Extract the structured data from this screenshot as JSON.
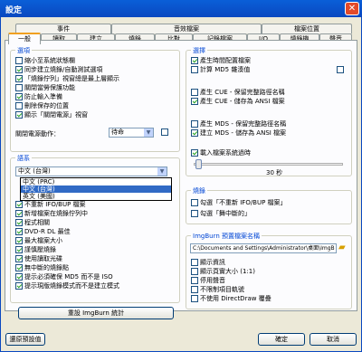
{
  "window": {
    "title": "設定",
    "close": "✕"
  },
  "tabs_back": [
    "事件",
    "音效檔案",
    "檔案位置"
  ],
  "tabs_front": [
    "一般",
    "讀取",
    "建立",
    "燒錄",
    "比對",
    "記錄檔案",
    "I/O",
    "燒錄機",
    "聲音"
  ],
  "options": {
    "title": "選項",
    "items": [
      {
        "label": "縮小至系統狀態欄",
        "checked": false
      },
      {
        "label": "同步建立燒錄/自動測試選項",
        "checked": true
      },
      {
        "label": "「燒錄佇列」視窗總是最上層顯示",
        "checked": true
      },
      {
        "label": "關閉當勞保護功能",
        "checked": false
      },
      {
        "label": "防止輸入準備",
        "checked": true
      },
      {
        "label": "刪除保存的位置",
        "checked": false
      },
      {
        "label": "顯示「關閉電源」視窗",
        "checked": true
      }
    ],
    "shutdown_label": "關閉電源動作：",
    "shutdown_value": "待命"
  },
  "language": {
    "title": "語系",
    "selected": "中文 (台灣)",
    "options": [
      "中文 (台灣)",
      "中文 (PRC)",
      "中文 (台灣)",
      "英文 (美國)"
    ],
    "items": [
      {
        "label": "不重新 IFO/BUP 檔案",
        "checked": true
      },
      {
        "label": "新增檔案在燒錄佇列中",
        "checked": true
      },
      {
        "label": "程式相關",
        "checked": true
      },
      {
        "label": "DVD-R DL 最佳",
        "checked": true
      },
      {
        "label": "最大檔案大小",
        "checked": true
      },
      {
        "label": "謹慎壓燒錄",
        "checked": true
      },
      {
        "label": "使用讀取光碟",
        "checked": true
      },
      {
        "label": "無中斷的燒錄點",
        "checked": true
      },
      {
        "label": "提示必須確保 MD5 而不是 ISO",
        "checked": true
      },
      {
        "label": "提示現版燒錄模式而不是建立模式",
        "checked": true
      }
    ],
    "reset_button": "重設 ImgBurn 統計"
  },
  "queue": {
    "title": "選擇",
    "items": [
      {
        "label": "產生時間配置檔案",
        "checked": true
      },
      {
        "label": "計算 MD5 雜湊值",
        "checked": false
      },
      {
        "label": "產生 CUE - 保留完整路徑名稱",
        "checked": false
      },
      {
        "label": "產生 CUE - 儲存為 ANSI 檔案",
        "checked": true
      },
      {
        "label": "產生 MDS - 保留完整路徑名稱",
        "checked": false
      },
      {
        "label": "建立 MDS - 儲存為 ANSI 檔案",
        "checked": true
      },
      {
        "label": "載入檔案系統過時",
        "checked": true
      }
    ],
    "slider_value": "30 秒"
  },
  "misc": {
    "title": "燒錄",
    "items": [
      {
        "label": "勾選「不重新 IFO/BUP 檔案」",
        "checked": false
      },
      {
        "label": "勾選「舞中斷的」",
        "checked": false
      }
    ]
  },
  "path": {
    "title": "ImgBurn 預置檔案名稱",
    "value": "C:\\Documents and Settings\\Administrator\\桌面\\ImgB",
    "items": [
      {
        "label": "顯示資訊",
        "checked": false
      },
      {
        "label": "顯示頁實大小 (1:1)",
        "checked": false
      },
      {
        "label": "停用聲音",
        "checked": false
      },
      {
        "label": "不限制項目軌號",
        "checked": false
      },
      {
        "label": "不使用 DirectDraw 覆疊",
        "checked": false
      }
    ]
  },
  "footer": {
    "restore": "還原預設值",
    "ok": "確定",
    "cancel": "取消"
  }
}
